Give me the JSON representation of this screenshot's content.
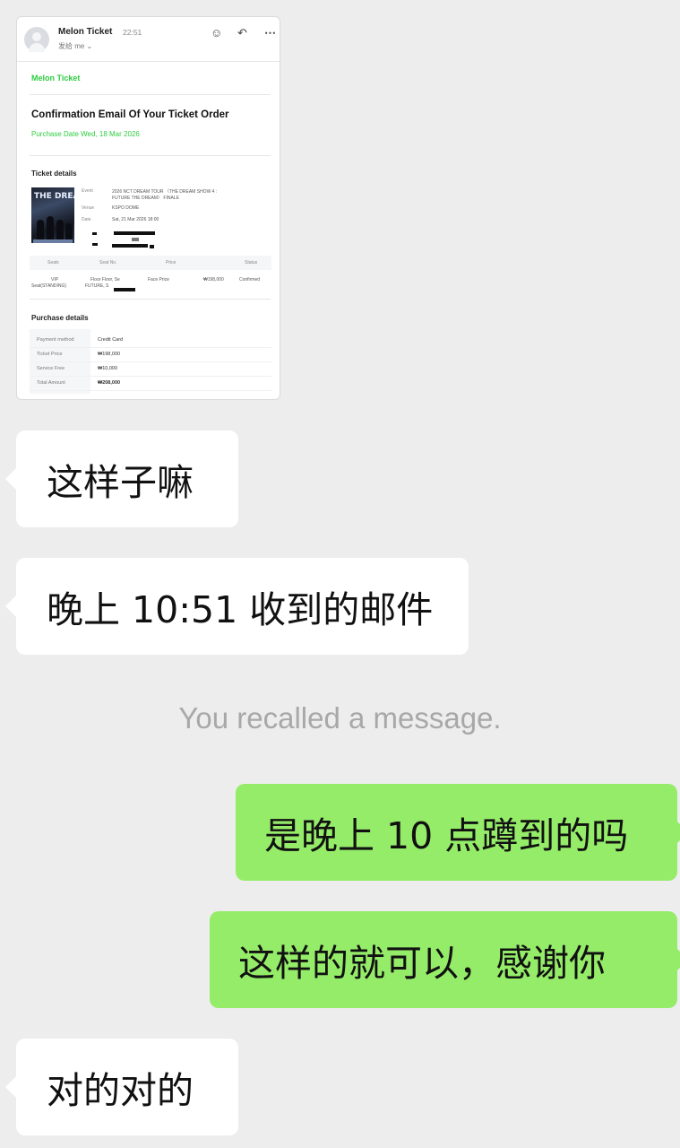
{
  "email": {
    "sender": "Melon Ticket",
    "time": "22:51",
    "to_line": "发给 me ⌄",
    "header_icons": [
      "emoji-icon",
      "reply-icon",
      "more-icon"
    ],
    "brand": "Melon Ticket",
    "title": "Confirmation Email Of Your Ticket Order",
    "purchase_date": "Purchase Date Wed, 18 Mar 2026",
    "ticket_details_heading": "Ticket details",
    "event_label": "Event",
    "event_value_line1": "2026 NCT DREAM TOUR 〈THE DREAM SHOW 4 :",
    "event_value_line2": "FUTURE THE DREAM〉 FINALE",
    "venue_label": "Venue",
    "venue_value": "KSPO DOME",
    "date_label": "Date",
    "date_value": "Sat, 21 Mar 2026 18:00",
    "poster_text": "THE DREAM",
    "table_headers": [
      "Seats",
      "Seat No.",
      "Price",
      "Status"
    ],
    "row_seat": "VIP",
    "row_seat2": "Seat(STANDING)",
    "row_seatno": "Floor Floor, Se",
    "row_seatno2": "FUTURE, S",
    "row_price_label": "Face Price",
    "row_price": "₩198,000",
    "row_status": "Confirmed",
    "purchase_heading": "Purchase details",
    "purchase_rows": [
      {
        "label": "Payment method",
        "value": "Credit Card"
      },
      {
        "label": "Ticket Price",
        "value": "₩198,000"
      },
      {
        "label": "Service Free",
        "value": "₩10,000"
      },
      {
        "label": "Total Amount",
        "value": "₩208,000"
      }
    ]
  },
  "messages": [
    {
      "side": "left",
      "text": "这样子嘛"
    },
    {
      "side": "left",
      "text": "晚上 10:51 收到的邮件"
    },
    {
      "side": "system",
      "text": "You recalled a message."
    },
    {
      "side": "right",
      "text": "是晚上 10 点蹲到的吗"
    },
    {
      "side": "right",
      "text": "这样的就可以，感谢你"
    },
    {
      "side": "left",
      "text": "对的对的"
    }
  ],
  "colors": {
    "background": "#ededed",
    "incoming_bubble": "#ffffff",
    "outgoing_bubble": "#95ec69",
    "melon_green": "#2ecc40"
  }
}
